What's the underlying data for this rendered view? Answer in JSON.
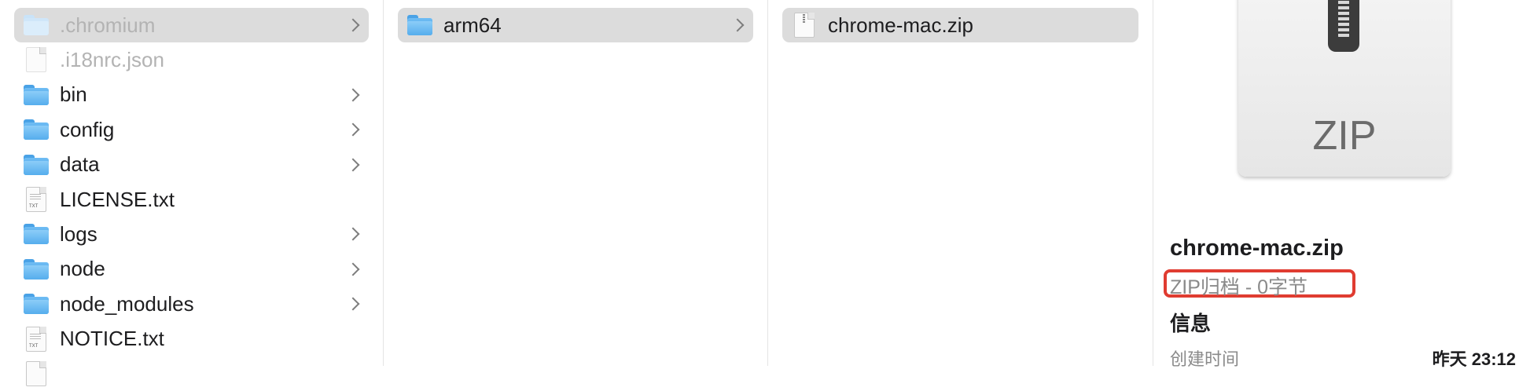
{
  "columns": [
    {
      "items": [
        {
          "label": ".chromium",
          "kind": "folder",
          "selected": true,
          "dim": true,
          "chevron": true
        },
        {
          "label": ".i18nrc.json",
          "kind": "file",
          "dim": true
        },
        {
          "label": "bin",
          "kind": "folder",
          "chevron": true
        },
        {
          "label": "config",
          "kind": "folder",
          "chevron": true
        },
        {
          "label": "data",
          "kind": "folder",
          "chevron": true
        },
        {
          "label": "LICENSE.txt",
          "kind": "txt"
        },
        {
          "label": "logs",
          "kind": "folder",
          "chevron": true
        },
        {
          "label": "node",
          "kind": "folder",
          "chevron": true
        },
        {
          "label": "node_modules",
          "kind": "folder",
          "chevron": true
        },
        {
          "label": "NOTICE.txt",
          "kind": "txt"
        },
        {
          "label": "",
          "kind": "file"
        }
      ]
    },
    {
      "items": [
        {
          "label": "arm64",
          "kind": "folder",
          "selected": true,
          "chevron": true
        }
      ]
    },
    {
      "items": [
        {
          "label": "chrome-mac.zip",
          "kind": "zip",
          "selected": true
        }
      ]
    }
  ],
  "preview": {
    "icon_label": "ZIP",
    "name": "chrome-mac.zip",
    "kind": "ZIP归档 - 0字节",
    "info_heading": "信息",
    "created_label": "创建时间",
    "created_value": "昨天 23:12",
    "highlight_color": "#e03c31"
  }
}
